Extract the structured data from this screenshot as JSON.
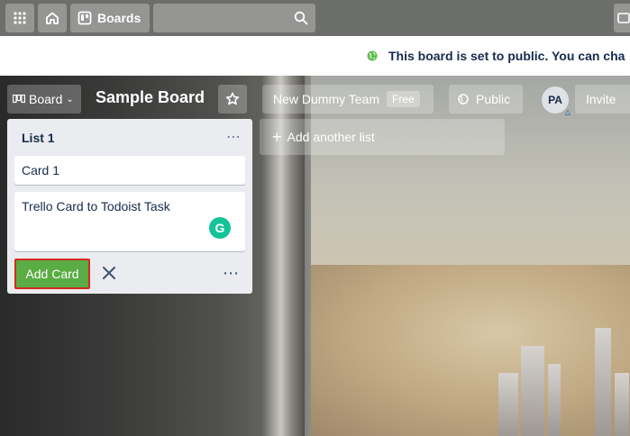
{
  "topnav": {
    "apps_icon": "grid-icon",
    "home_icon": "home-icon",
    "boards_label": "Boards",
    "search_placeholder": ""
  },
  "banner": {
    "text": "This board is set to public. You can cha",
    "icon": "globe-icon",
    "icon_color": "#61bd4f"
  },
  "board_header": {
    "view_label": "Board",
    "board_name": "Sample Board",
    "team_label": "New Dummy Team",
    "team_badge": "Free",
    "visibility_label": "Public",
    "avatar_initials": "PA",
    "invite_label": "Invite"
  },
  "list": {
    "title": "List 1",
    "cards": [
      "Card 1"
    ],
    "composer_text": "Trello Card to Todoist Task",
    "add_card_label": "Add Card",
    "add_card_color": "#5aac44",
    "highlight_color": "#d42b1e"
  },
  "add_list": {
    "label": "Add another list"
  }
}
